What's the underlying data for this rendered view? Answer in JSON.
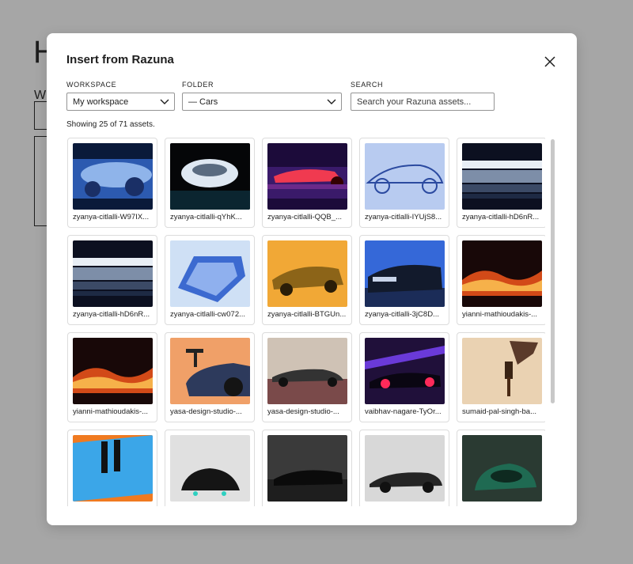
{
  "background": {
    "heading": "H",
    "label": "W"
  },
  "modal": {
    "title": "Insert from Razuna",
    "workspace": {
      "label": "WORKSPACE",
      "value": "My workspace"
    },
    "folder": {
      "label": "FOLDER",
      "value": "— Cars"
    },
    "search": {
      "label": "SEARCH",
      "placeholder": "Search your Razuna assets..."
    },
    "count_text": "Showing 25 of 71 assets."
  },
  "assets": [
    {
      "name": "zyanya-citlalli-W97IX...",
      "thumb": "car-blue-motion"
    },
    {
      "name": "zyanya-citlalli-qYhK...",
      "thumb": "car-glass-front"
    },
    {
      "name": "zyanya-citlalli-QQB_...",
      "thumb": "car-red-neon"
    },
    {
      "name": "zyanya-citlalli-IYUjS8...",
      "thumb": "car-xray-blue"
    },
    {
      "name": "zyanya-citlalli-hD6nR...",
      "thumb": "car-motion-blur"
    },
    {
      "name": "zyanya-citlalli-hD6nR...",
      "thumb": "car-motion-blur"
    },
    {
      "name": "zyanya-citlalli-cw072...",
      "thumb": "car-xray-chassis"
    },
    {
      "name": "zyanya-citlalli-BTGUn...",
      "thumb": "car-gold-convertible"
    },
    {
      "name": "zyanya-citlalli-3jC8D...",
      "thumb": "car-classic-blue"
    },
    {
      "name": "yianni-mathioudakis-...",
      "thumb": "abstract-red-wave"
    },
    {
      "name": "yianni-mathioudakis-...",
      "thumb": "abstract-red-wave"
    },
    {
      "name": "yasa-design-studio-...",
      "thumb": "car-orange-spoiler"
    },
    {
      "name": "yasa-design-studio-...",
      "thumb": "car-field-sunset"
    },
    {
      "name": "vaibhav-nagare-TyOr...",
      "thumb": "car-purple-neon"
    },
    {
      "name": "sumaid-pal-singh-ba...",
      "thumb": "oil-pour"
    },
    {
      "name": "...",
      "thumb": "car-blue-top"
    },
    {
      "name": "...",
      "thumb": "car-black-studio"
    },
    {
      "name": "...",
      "thumb": "car-black-dark"
    },
    {
      "name": "...",
      "thumb": "car-black-side"
    },
    {
      "name": "...",
      "thumb": "car-green-dark"
    }
  ],
  "colors": {
    "accent": "#1e1e1e",
    "border": "#949494"
  }
}
